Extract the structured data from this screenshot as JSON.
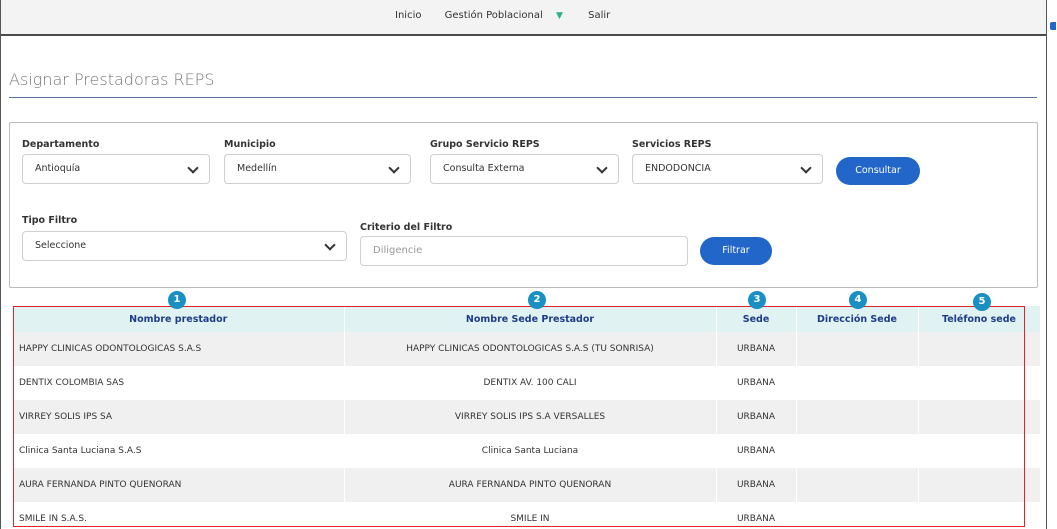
{
  "nav": {
    "inicio": "Inicio",
    "gestion": "Gestión Poblacional",
    "salir": "Salir"
  },
  "page": {
    "title": "Asignar Prestadoras REPS"
  },
  "filters": {
    "departamento": {
      "label": "Departamento",
      "value": "Antioquía"
    },
    "municipio": {
      "label": "Municipio",
      "value": "Medellín"
    },
    "grupo": {
      "label": "Grupo Servicio REPS",
      "value": "Consulta Externa"
    },
    "servicios": {
      "label": "Servicios REPS",
      "value": "ENDODONCIA"
    },
    "consultar": "Consultar",
    "tipo_filtro": {
      "label": "Tipo Filtro",
      "value": "Seleccione"
    },
    "criterio": {
      "label": "Criterio del Filtro",
      "placeholder": "Diligencie"
    },
    "filtrar": "Filtrar"
  },
  "table": {
    "headers": [
      "Nombre prestador",
      "Nombre Sede Prestador",
      "Sede",
      "Dirección Sede",
      "Teléfono sede"
    ],
    "badges": [
      "1",
      "2",
      "3",
      "4",
      "5"
    ],
    "rows": [
      [
        "HAPPY CLINICAS ODONTOLOGICAS S.A.S",
        "HAPPY CLINICAS ODONTOLOGICAS S.A.S (TU SONRISA)",
        "URBANA",
        "",
        ""
      ],
      [
        "DENTIX COLOMBIA SAS",
        "DENTIX AV. 100 CALI",
        "URBANA",
        "",
        ""
      ],
      [
        "VIRREY SOLIS IPS SA",
        "VIRREY SOLIS IPS S.A VERSALLES",
        "URBANA",
        "",
        ""
      ],
      [
        "Clinica Santa Luciana S.A.S",
        "Clinica Santa Luciana",
        "URBANA",
        "",
        ""
      ],
      [
        "AURA FERNANDA PINTO QUENORAN",
        "AURA FERNANDA PINTO QUENORAN",
        "URBANA",
        "",
        ""
      ],
      [
        "SMILE IN S.A.S.",
        "SMILE IN",
        "URBANA",
        "",
        ""
      ]
    ]
  },
  "colors": {
    "primary": "#2166c8",
    "header_bg": "#e0f2f1",
    "header_text": "#1f3c88",
    "highlight": "#e0242c",
    "badge": "#1a8fc4"
  }
}
